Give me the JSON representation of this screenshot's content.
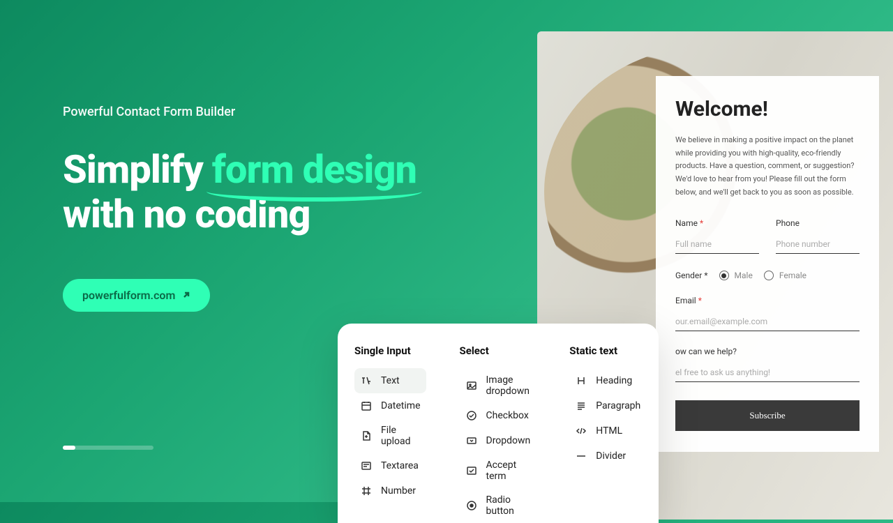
{
  "hero": {
    "eyebrow": "Powerful Contact Form Builder",
    "headline_1": "Simplify ",
    "headline_accent": "form design",
    "headline_2": "with no coding",
    "cta": "powerfulform.com"
  },
  "panel": {
    "col1": {
      "heading": "Single Input",
      "items": [
        "Text",
        "Datetime",
        "File upload",
        "Textarea",
        "Number"
      ]
    },
    "col2": {
      "heading": "Select",
      "items": [
        "Image dropdown",
        "Checkbox",
        "Dropdown",
        "Accept term",
        "Radio button"
      ]
    },
    "col3": {
      "heading": "Static text",
      "items": [
        "Heading",
        "Paragraph",
        "HTML",
        "Divider"
      ]
    }
  },
  "form": {
    "title": "Welcome!",
    "desc": "We believe in making a positive impact on the planet while providing you with high-quality, eco-friendly products. Have a question, comment, or suggestion? We'd love to hear from you! Please fill out the form below, and we'll get back to you as soon as possible.",
    "name_label": "Name",
    "name_ph": "Full name",
    "phone_label": "Phone",
    "phone_ph": "Phone number",
    "gender_label": "Gender",
    "gender_male": "Male",
    "gender_female": "Female",
    "email_label": "Email",
    "email_ph": "our.email@example.com",
    "help_label": "ow can we help?",
    "help_ph": "el free to ask us anything!",
    "submit": "Subscribe",
    "asterisk": "*"
  }
}
